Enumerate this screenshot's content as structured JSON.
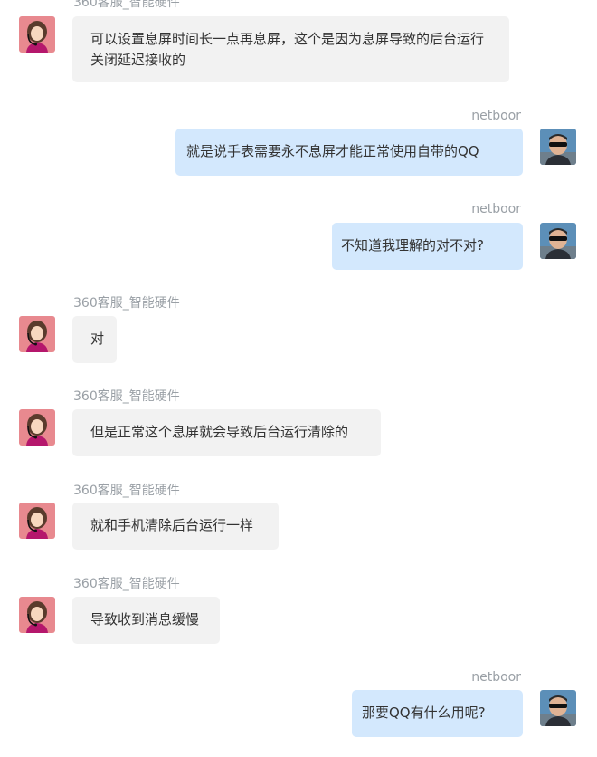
{
  "agent_name": "360客服_智能硬件",
  "user_name": "netboor",
  "messages": [
    {
      "from": "agent",
      "sender": "360客服_智能硬件",
      "text": "可以设置息屏时间长一点再息屏，这个是因为息屏导致的后台运行关闭延迟接收的"
    },
    {
      "from": "user",
      "sender": "netboor",
      "text": "就是说手表需要永不息屏才能正常使用自带的QQ"
    },
    {
      "from": "user",
      "sender": "netboor",
      "text": "不知道我理解的对不对?"
    },
    {
      "from": "agent",
      "sender": "360客服_智能硬件",
      "text": "对"
    },
    {
      "from": "agent",
      "sender": "360客服_智能硬件",
      "text": "但是正常这个息屏就会导致后台运行清除的"
    },
    {
      "from": "agent",
      "sender": "360客服_智能硬件",
      "text": "就和手机清除后台运行一样"
    },
    {
      "from": "agent",
      "sender": "360客服_智能硬件",
      "text": "导致收到消息缓慢"
    },
    {
      "from": "user",
      "sender": "netboor",
      "text": "那要QQ有什么用呢?"
    }
  ]
}
